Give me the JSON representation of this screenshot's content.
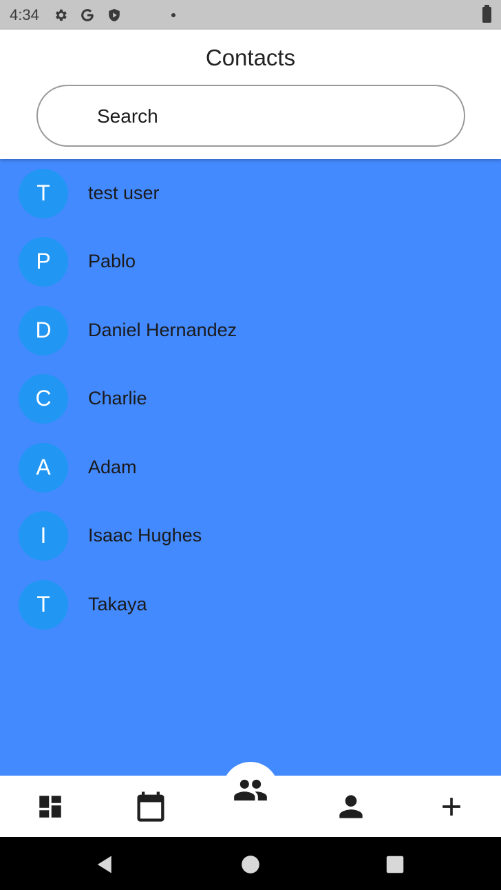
{
  "status_bar": {
    "time": "4:34",
    "icons": [
      "gear-icon",
      "google-icon",
      "shield-icon",
      "notification-dot-icon",
      "battery-icon"
    ]
  },
  "header": {
    "title": "Contacts"
  },
  "search": {
    "placeholder": "Search",
    "value": ""
  },
  "colors": {
    "list_background": "#448aff",
    "avatar_background": "#2196f3",
    "avatar_text": "#ffffff"
  },
  "contacts": [
    {
      "initial": "T",
      "name": "test user"
    },
    {
      "initial": "P",
      "name": "Pablo"
    },
    {
      "initial": "D",
      "name": "Daniel Hernandez"
    },
    {
      "initial": "C",
      "name": "Charlie"
    },
    {
      "initial": "A",
      "name": "Adam"
    },
    {
      "initial": "I",
      "name": "Isaac Hughes"
    },
    {
      "initial": "T",
      "name": "Takaya"
    }
  ],
  "bottom_nav": {
    "items": [
      {
        "icon": "dashboard-icon",
        "active": false
      },
      {
        "icon": "calendar-icon",
        "active": false
      },
      {
        "icon": "people-icon",
        "active": true
      },
      {
        "icon": "person-icon",
        "active": false
      },
      {
        "icon": "plus-icon",
        "active": false
      }
    ]
  },
  "system_nav": {
    "icons": [
      "back-icon",
      "home-icon",
      "recents-icon"
    ]
  }
}
